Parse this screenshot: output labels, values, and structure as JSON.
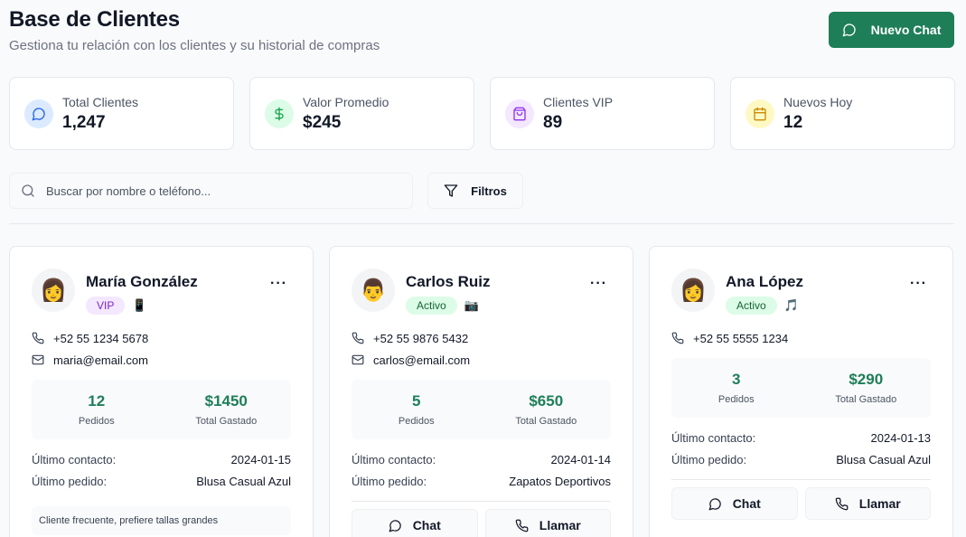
{
  "header": {
    "title": "Base de Clientes",
    "subtitle": "Gestiona tu relación con los clientes y su historial de compras",
    "new_chat_label": "Nuevo Chat"
  },
  "stats": [
    {
      "label": "Total Clientes",
      "value": "1,247",
      "icon": "chat-icon",
      "bg": "#dbeafe",
      "color": "#2563eb"
    },
    {
      "label": "Valor Promedio",
      "value": "$245",
      "icon": "dollar-icon",
      "bg": "#dcfce7",
      "color": "#16a34a"
    },
    {
      "label": "Clientes VIP",
      "value": "89",
      "icon": "shopping-bag-icon",
      "bg": "#f3e8ff",
      "color": "#9333ea"
    },
    {
      "label": "Nuevos Hoy",
      "value": "12",
      "icon": "calendar-icon",
      "bg": "#fef9c3",
      "color": "#ca8a04"
    }
  ],
  "search": {
    "placeholder": "Buscar por nombre o teléfono..."
  },
  "filter_label": "Filtros",
  "labels": {
    "orders": "Pedidos",
    "total_spent": "Total Gastado",
    "last_contact": "Último contacto:",
    "last_order": "Último pedido:",
    "chat": "Chat",
    "call": "Llamar",
    "more": "···"
  },
  "clients": [
    {
      "name": "María González",
      "avatar": "👩",
      "status": "VIP",
      "channel": "📱",
      "phone": "+52 55 1234 5678",
      "email": "maria@email.com",
      "orders": "12",
      "spent": "$1450",
      "last_contact": "2024-01-15",
      "last_order": "Blusa Casual Azul",
      "note": "Cliente frecuente, prefiere tallas grandes"
    },
    {
      "name": "Carlos Ruiz",
      "avatar": "👨",
      "status": "Activo",
      "channel": "📷",
      "phone": "+52 55 9876 5432",
      "email": "carlos@email.com",
      "orders": "5",
      "spent": "$650",
      "last_contact": "2024-01-14",
      "last_order": "Zapatos Deportivos"
    },
    {
      "name": "Ana López",
      "avatar": "👩",
      "status": "Activo",
      "channel": "🎵",
      "phone": "+52 55 5555 1234",
      "orders": "3",
      "spent": "$290",
      "last_contact": "2024-01-13",
      "last_order": "Blusa Casual Azul"
    }
  ]
}
